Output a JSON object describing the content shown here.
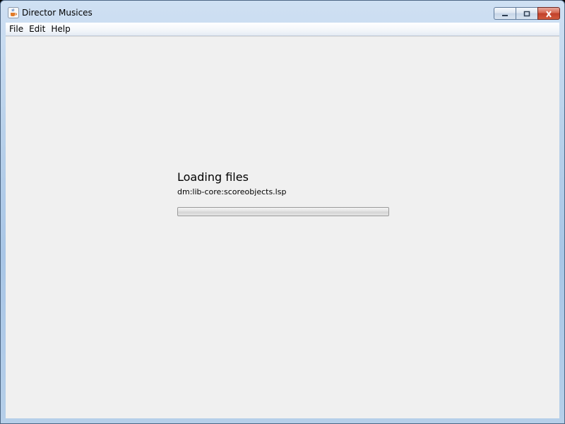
{
  "window": {
    "title": "Director Musices",
    "app_icon": "java-coffee-cup-icon",
    "buttons": {
      "minimize_icon": "minimize-icon",
      "maximize_icon": "maximize-icon",
      "close_icon": "close-icon"
    }
  },
  "menubar": {
    "items": [
      {
        "label": "File"
      },
      {
        "label": "Edit"
      },
      {
        "label": "Help"
      }
    ]
  },
  "loading": {
    "title": "Loading files",
    "current_file": "dm:lib-core:scoreobjects.lsp",
    "progress": 0
  },
  "colors": {
    "content_background": "#f0f0f0",
    "titlebar": "#b9d1ea",
    "close_button": "#c7462e"
  }
}
